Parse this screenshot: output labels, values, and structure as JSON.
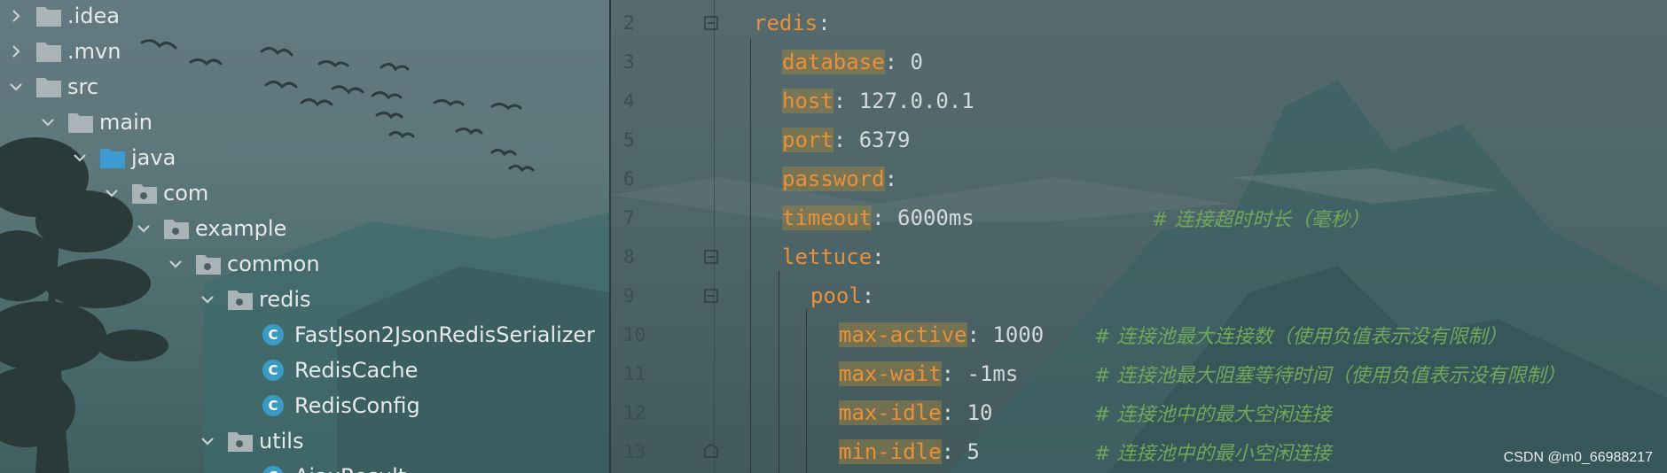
{
  "tree": {
    "items": [
      {
        "label": ".idea",
        "icon": "folder-icon",
        "expanded": false
      },
      {
        "label": ".mvn",
        "icon": "folder-icon",
        "expanded": false
      },
      {
        "label": "src",
        "icon": "folder-icon",
        "expanded": true
      },
      {
        "label": "main",
        "icon": "folder-icon",
        "expanded": true
      },
      {
        "label": "java",
        "icon": "source-folder-icon",
        "expanded": true
      },
      {
        "label": "com",
        "icon": "package-icon",
        "expanded": true
      },
      {
        "label": "example",
        "icon": "package-icon",
        "expanded": true
      },
      {
        "label": "common",
        "icon": "package-icon",
        "expanded": true
      },
      {
        "label": "redis",
        "icon": "package-icon",
        "expanded": true
      },
      {
        "label": "FastJson2JsonRedisSerializer",
        "icon": "class-icon"
      },
      {
        "label": "RedisCache",
        "icon": "class-icon"
      },
      {
        "label": "RedisConfig",
        "icon": "class-icon"
      },
      {
        "label": "utils",
        "icon": "package-icon",
        "expanded": true
      },
      {
        "label": "AjaxResult",
        "icon": "class-icon"
      }
    ],
    "class_badge": "C"
  },
  "editor": {
    "lines": [
      {
        "num": "2",
        "key": "redis",
        "sep": ":",
        "value": "",
        "comment": ""
      },
      {
        "num": "3",
        "key": "database",
        "sep": ":",
        "value": " 0",
        "comment": ""
      },
      {
        "num": "4",
        "key": "host",
        "sep": ":",
        "value": " 127.0.0.1",
        "comment": ""
      },
      {
        "num": "5",
        "key": "port",
        "sep": ":",
        "value": " 6379",
        "comment": ""
      },
      {
        "num": "6",
        "key": "password",
        "sep": ":",
        "value": "",
        "comment": ""
      },
      {
        "num": "7",
        "key": "timeout",
        "sep": ":",
        "value": " 6000ms",
        "comment": "# 连接超时时长（毫秒）"
      },
      {
        "num": "8",
        "key": "lettuce",
        "sep": ":",
        "value": "",
        "comment": ""
      },
      {
        "num": "9",
        "key": "pool",
        "sep": ":",
        "value": "",
        "comment": ""
      },
      {
        "num": "10",
        "key": "max-active",
        "sep": ":",
        "value": " 1000",
        "comment": "# 连接池最大连接数（使用负值表示没有限制）"
      },
      {
        "num": "11",
        "key": "max-wait",
        "sep": ":",
        "value": " -1ms",
        "comment": "# 连接池最大阻塞等待时间（使用负值表示没有限制）"
      },
      {
        "num": "12",
        "key": "max-idle",
        "sep": ":",
        "value": " 10",
        "comment": "# 连接池中的最大空闲连接"
      },
      {
        "num": "13",
        "key": "min-idle",
        "sep": ":",
        "value": " 5",
        "comment": "# 连接池中的最小空闲连接"
      }
    ]
  },
  "watermark": "CSDN @m0_66988217",
  "colors": {
    "yaml_key": "#e8913a",
    "comment": "#6fa85a",
    "class_badge": "#3a9bc2",
    "source_folder": "#3c9bd0"
  }
}
